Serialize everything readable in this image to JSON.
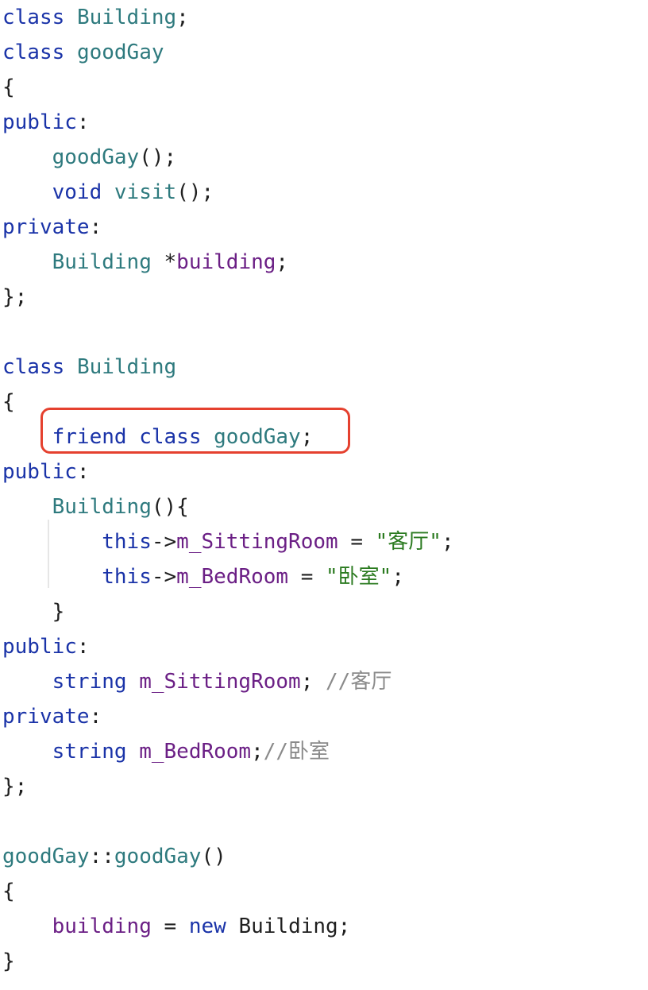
{
  "editor": {
    "lines": [
      {
        "indent": "",
        "tokens": [
          {
            "t": "class",
            "c": "kw"
          },
          {
            "t": " "
          },
          {
            "t": "Building",
            "c": "ty"
          },
          {
            "t": ";"
          }
        ]
      },
      {
        "indent": "",
        "tokens": [
          {
            "t": "class",
            "c": "kw"
          },
          {
            "t": " "
          },
          {
            "t": "goodGay",
            "c": "ty"
          }
        ]
      },
      {
        "indent": "",
        "tokens": [
          {
            "t": "{"
          }
        ]
      },
      {
        "indent": "",
        "tokens": [
          {
            "t": "public",
            "c": "kw"
          },
          {
            "t": ":"
          }
        ]
      },
      {
        "indent": "    ",
        "tokens": [
          {
            "t": "goodGay",
            "c": "ty"
          },
          {
            "t": "();"
          }
        ]
      },
      {
        "indent": "    ",
        "tokens": [
          {
            "t": "void",
            "c": "kw"
          },
          {
            "t": " "
          },
          {
            "t": "visit",
            "c": "ty"
          },
          {
            "t": "();"
          }
        ]
      },
      {
        "indent": "",
        "tokens": [
          {
            "t": "private",
            "c": "kw"
          },
          {
            "t": ":"
          }
        ]
      },
      {
        "indent": "    ",
        "tokens": [
          {
            "t": "Building",
            "c": "ty"
          },
          {
            "t": " *"
          },
          {
            "t": "building",
            "c": "mem"
          },
          {
            "t": ";"
          }
        ]
      },
      {
        "indent": "",
        "tokens": [
          {
            "t": "};"
          }
        ]
      },
      {
        "indent": "",
        "tokens": []
      },
      {
        "indent": "",
        "tokens": [
          {
            "t": "class",
            "c": "kw"
          },
          {
            "t": " "
          },
          {
            "t": "Building",
            "c": "ty"
          }
        ]
      },
      {
        "indent": "",
        "tokens": [
          {
            "t": "{"
          }
        ]
      },
      {
        "indent": "    ",
        "tokens": [
          {
            "t": "friend",
            "c": "kw"
          },
          {
            "t": " "
          },
          {
            "t": "class",
            "c": "kw"
          },
          {
            "t": " "
          },
          {
            "t": "goodGay",
            "c": "ty"
          },
          {
            "t": ";"
          }
        ]
      },
      {
        "indent": "",
        "tokens": [
          {
            "t": "public",
            "c": "kw"
          },
          {
            "t": ":"
          }
        ]
      },
      {
        "indent": "    ",
        "tokens": [
          {
            "t": "Building",
            "c": "ty"
          },
          {
            "t": "(){"
          }
        ]
      },
      {
        "indent": "        ",
        "tokens": [
          {
            "t": "this",
            "c": "kw"
          },
          {
            "t": "->"
          },
          {
            "t": "m_SittingRoom",
            "c": "mem"
          },
          {
            "t": " = "
          },
          {
            "t": "\"客厅\"",
            "c": "str"
          },
          {
            "t": ";"
          }
        ]
      },
      {
        "indent": "        ",
        "tokens": [
          {
            "t": "this",
            "c": "kw"
          },
          {
            "t": "->"
          },
          {
            "t": "m_BedRoom",
            "c": "mem"
          },
          {
            "t": " = "
          },
          {
            "t": "\"卧室\"",
            "c": "str"
          },
          {
            "t": ";"
          }
        ]
      },
      {
        "indent": "    ",
        "tokens": [
          {
            "t": "}"
          }
        ]
      },
      {
        "indent": "",
        "tokens": [
          {
            "t": "public",
            "c": "kw"
          },
          {
            "t": ":"
          }
        ]
      },
      {
        "indent": "    ",
        "tokens": [
          {
            "t": "string",
            "c": "kw"
          },
          {
            "t": " "
          },
          {
            "t": "m_SittingRoom",
            "c": "mem"
          },
          {
            "t": "; "
          },
          {
            "t": "//客厅",
            "c": "com"
          }
        ]
      },
      {
        "indent": "",
        "tokens": [
          {
            "t": "private",
            "c": "kw"
          },
          {
            "t": ":"
          }
        ]
      },
      {
        "indent": "    ",
        "tokens": [
          {
            "t": "string",
            "c": "kw"
          },
          {
            "t": " "
          },
          {
            "t": "m_BedRoom",
            "c": "mem"
          },
          {
            "t": ";"
          },
          {
            "t": "//卧室",
            "c": "com"
          }
        ]
      },
      {
        "indent": "",
        "tokens": [
          {
            "t": "};"
          }
        ]
      },
      {
        "indent": "",
        "tokens": []
      },
      {
        "indent": "",
        "tokens": [
          {
            "t": "goodGay",
            "c": "ty"
          },
          {
            "t": "::"
          },
          {
            "t": "goodGay",
            "c": "ty"
          },
          {
            "t": "()"
          }
        ]
      },
      {
        "indent": "",
        "tokens": [
          {
            "t": "{"
          }
        ]
      },
      {
        "indent": "    ",
        "tokens": [
          {
            "t": "building",
            "c": "mem"
          },
          {
            "t": " = "
          },
          {
            "t": "new",
            "c": "kw"
          },
          {
            "t": " Building;"
          }
        ]
      },
      {
        "indent": "",
        "tokens": [
          {
            "t": "}"
          }
        ]
      }
    ]
  },
  "colors": {
    "keyword": "#1a33a8",
    "type": "#2e7a7e",
    "member": "#6b1f85",
    "string": "#2a7a1f",
    "comment": "#8a8a8a",
    "highlight_border": "#e5412f"
  }
}
